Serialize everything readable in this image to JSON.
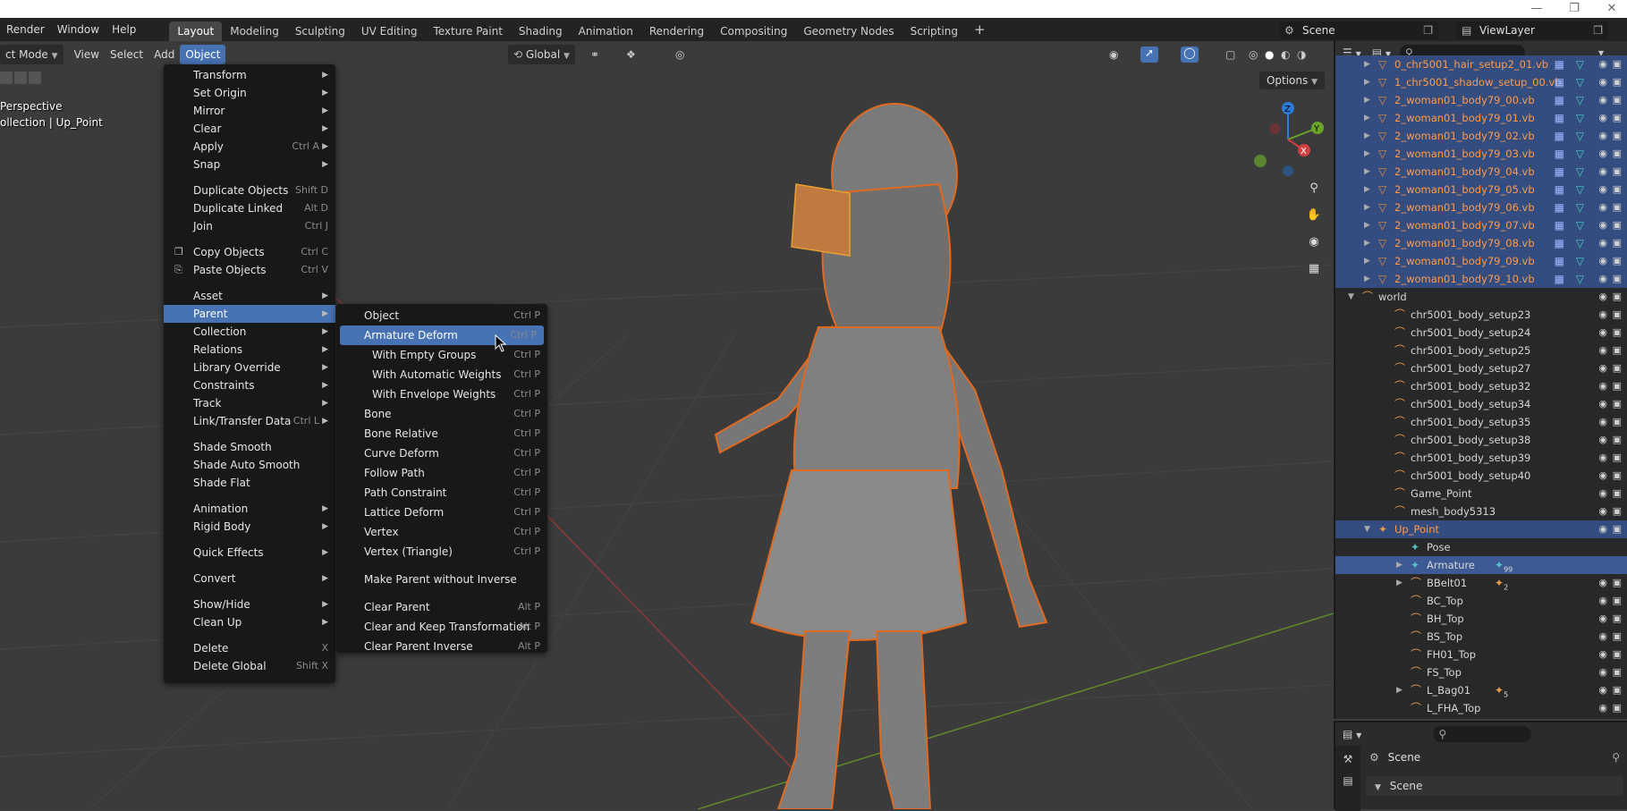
{
  "topbar": {
    "menus": [
      "Render",
      "Window",
      "Help"
    ],
    "workspaces": [
      "Layout",
      "Modeling",
      "Sculpting",
      "UV Editing",
      "Texture Paint",
      "Shading",
      "Animation",
      "Rendering",
      "Compositing",
      "Geometry Nodes",
      "Scripting"
    ],
    "active_workspace": "Layout",
    "add_tab": "+",
    "scene": "Scene",
    "view_layer": "ViewLayer"
  },
  "viewport": {
    "mode": "ct Mode",
    "menus": [
      "View",
      "Select",
      "Add"
    ],
    "object_menu": "Object",
    "orientation": "Global",
    "options_label": "Options",
    "overlay_line1": "Perspective",
    "overlay_line2": "ollection | Up_Point",
    "gizmo": {
      "z": "Z",
      "y": "Y",
      "x": "X"
    }
  },
  "object_menu": {
    "groups": [
      [
        {
          "label": "Transform",
          "submenu": true
        },
        {
          "label": "Set Origin",
          "submenu": true
        },
        {
          "label": "Mirror",
          "submenu": true
        },
        {
          "label": "Clear",
          "submenu": true
        },
        {
          "label": "Apply",
          "shortcut": "Ctrl A",
          "submenu": true
        },
        {
          "label": "Snap",
          "submenu": true
        }
      ],
      [
        {
          "label": "Duplicate Objects",
          "shortcut": "Shift D"
        },
        {
          "label": "Duplicate Linked",
          "shortcut": "Alt D"
        },
        {
          "label": "Join",
          "shortcut": "Ctrl J"
        }
      ],
      [
        {
          "label": "Copy Objects",
          "shortcut": "Ctrl C",
          "icon": "copy-icon"
        },
        {
          "label": "Paste Objects",
          "shortcut": "Ctrl V",
          "icon": "paste-icon"
        }
      ],
      [
        {
          "label": "Asset",
          "submenu": true
        },
        {
          "label": "Parent",
          "submenu": true,
          "highlighted": true
        },
        {
          "label": "Collection",
          "submenu": true
        },
        {
          "label": "Relations",
          "submenu": true
        },
        {
          "label": "Library Override",
          "submenu": true
        },
        {
          "label": "Constraints",
          "submenu": true
        },
        {
          "label": "Track",
          "submenu": true
        },
        {
          "label": "Link/Transfer Data",
          "shortcut": "Ctrl L",
          "submenu": true
        }
      ],
      [
        {
          "label": "Shade Smooth"
        },
        {
          "label": "Shade Auto Smooth"
        },
        {
          "label": "Shade Flat"
        }
      ],
      [
        {
          "label": "Animation",
          "submenu": true
        },
        {
          "label": "Rigid Body",
          "submenu": true
        }
      ],
      [
        {
          "label": "Quick Effects",
          "submenu": true
        }
      ],
      [
        {
          "label": "Convert",
          "submenu": true
        }
      ],
      [
        {
          "label": "Show/Hide",
          "submenu": true
        },
        {
          "label": "Clean Up",
          "submenu": true
        }
      ],
      [
        {
          "label": "Delete",
          "shortcut": "X"
        },
        {
          "label": "Delete Global",
          "shortcut": "Shift X"
        }
      ]
    ]
  },
  "parent_menu": {
    "groups": [
      [
        {
          "label": "Object",
          "shortcut": "Ctrl P"
        },
        {
          "label": "Armature Deform",
          "shortcut": "Ctrl P",
          "highlighted": true
        },
        {
          "label": "With Empty Groups",
          "shortcut": "Ctrl P",
          "sub": true
        },
        {
          "label": "With Automatic Weights",
          "shortcut": "Ctrl P",
          "sub": true
        },
        {
          "label": "With Envelope Weights",
          "shortcut": "Ctrl P",
          "sub": true
        },
        {
          "label": "Bone",
          "shortcut": "Ctrl P"
        },
        {
          "label": "Bone Relative",
          "shortcut": "Ctrl P"
        },
        {
          "label": "Curve Deform",
          "shortcut": "Ctrl P"
        },
        {
          "label": "Follow Path",
          "shortcut": "Ctrl P"
        },
        {
          "label": "Path Constraint",
          "shortcut": "Ctrl P"
        },
        {
          "label": "Lattice Deform",
          "shortcut": "Ctrl P"
        },
        {
          "label": "Vertex",
          "shortcut": "Ctrl P"
        },
        {
          "label": "Vertex (Triangle)",
          "shortcut": "Ctrl P"
        }
      ],
      [
        {
          "label": "Make Parent without Inverse"
        }
      ],
      [
        {
          "label": "Clear Parent",
          "shortcut": "Alt P"
        },
        {
          "label": "Clear and Keep Transformation",
          "shortcut": "Alt P"
        },
        {
          "label": "Clear Parent Inverse",
          "shortcut": "Alt P"
        }
      ]
    ]
  },
  "outliner": {
    "rows": [
      {
        "label": "0_chr5001_hair_setup2_01.vb",
        "type": "mesh",
        "depth": 1,
        "selected": true,
        "tri": true
      },
      {
        "label": "1_chr5001_shadow_setup_00.vb",
        "type": "mesh",
        "depth": 1,
        "selected": true,
        "tri": true
      },
      {
        "label": "2_woman01_body79_00.vb",
        "type": "mesh",
        "depth": 1,
        "selected": true,
        "tri": true
      },
      {
        "label": "2_woman01_body79_01.vb",
        "type": "mesh",
        "depth": 1,
        "selected": true,
        "tri": true
      },
      {
        "label": "2_woman01_body79_02.vb",
        "type": "mesh",
        "depth": 1,
        "selected": true,
        "tri": true
      },
      {
        "label": "2_woman01_body79_03.vb",
        "type": "mesh",
        "depth": 1,
        "selected": true,
        "tri": true
      },
      {
        "label": "2_woman01_body79_04.vb",
        "type": "mesh",
        "depth": 1,
        "selected": true,
        "tri": true
      },
      {
        "label": "2_woman01_body79_05.vb",
        "type": "mesh",
        "depth": 1,
        "selected": true,
        "tri": true
      },
      {
        "label": "2_woman01_body79_06.vb",
        "type": "mesh",
        "depth": 1,
        "selected": true,
        "tri": true
      },
      {
        "label": "2_woman01_body79_07.vb",
        "type": "mesh",
        "depth": 1,
        "selected": true,
        "tri": true
      },
      {
        "label": "2_woman01_body79_08.vb",
        "type": "mesh",
        "depth": 1,
        "selected": true,
        "tri": true
      },
      {
        "label": "2_woman01_body79_09.vb",
        "type": "mesh",
        "depth": 1,
        "selected": true,
        "tri": true
      },
      {
        "label": "2_woman01_body79_10.vb",
        "type": "mesh",
        "depth": 1,
        "selected": true,
        "tri": true
      },
      {
        "label": "world",
        "type": "empty",
        "depth": 0,
        "expanded": true,
        "tri": true
      },
      {
        "label": "chr5001_body_setup23",
        "type": "empty",
        "depth": 2
      },
      {
        "label": "chr5001_body_setup24",
        "type": "empty",
        "depth": 2
      },
      {
        "label": "chr5001_body_setup25",
        "type": "empty",
        "depth": 2
      },
      {
        "label": "chr5001_body_setup27",
        "type": "empty",
        "depth": 2
      },
      {
        "label": "chr5001_body_setup32",
        "type": "empty",
        "depth": 2
      },
      {
        "label": "chr5001_body_setup34",
        "type": "empty",
        "depth": 2
      },
      {
        "label": "chr5001_body_setup35",
        "type": "empty",
        "depth": 2
      },
      {
        "label": "chr5001_body_setup38",
        "type": "empty",
        "depth": 2
      },
      {
        "label": "chr5001_body_setup39",
        "type": "empty",
        "depth": 2
      },
      {
        "label": "chr5001_body_setup40",
        "type": "empty",
        "depth": 2
      },
      {
        "label": "Game_Point",
        "type": "empty",
        "depth": 2
      },
      {
        "label": "mesh_body5313",
        "type": "empty",
        "depth": 2
      },
      {
        "label": "Up_Point",
        "type": "armature",
        "depth": 1,
        "selected": true,
        "expanded": true,
        "tri": true,
        "orange": true
      },
      {
        "label": "Pose",
        "type": "pose",
        "depth": 3
      },
      {
        "label": "Armature",
        "type": "armature-data",
        "depth": 3,
        "active": true,
        "tri": true,
        "badge": "99"
      },
      {
        "label": "BBelt01",
        "type": "empty",
        "depth": 3,
        "tri": true,
        "badge": "2"
      },
      {
        "label": "BC_Top",
        "type": "empty",
        "depth": 3
      },
      {
        "label": "BH_Top",
        "type": "empty",
        "depth": 3
      },
      {
        "label": "BS_Top",
        "type": "empty",
        "depth": 3
      },
      {
        "label": "FH01_Top",
        "type": "empty",
        "depth": 3
      },
      {
        "label": "FS_Top",
        "type": "empty",
        "depth": 3
      },
      {
        "label": "L_Bag01",
        "type": "empty",
        "depth": 3,
        "tri": true,
        "badge": "5"
      },
      {
        "label": "L_FHA_Top",
        "type": "empty",
        "depth": 3
      }
    ]
  },
  "properties": {
    "scene_label": "Scene",
    "panel_label": "Scene"
  }
}
